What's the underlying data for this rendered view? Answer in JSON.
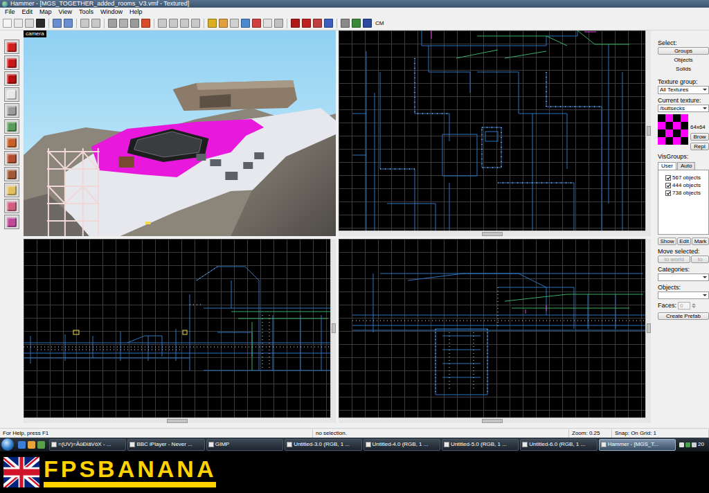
{
  "window": {
    "title": "Hammer - [MGS_TOGETHER_added_rooms_V3.vmf - Textured]"
  },
  "menu": [
    "File",
    "Edit",
    "Map",
    "View",
    "Tools",
    "Window",
    "Help"
  ],
  "toolbar": {
    "label": "CM"
  },
  "viewports": [
    {
      "label": "camera"
    }
  ],
  "select": {
    "label": "Select:",
    "buttons": [
      "Groups",
      "Objects",
      "Solids"
    ]
  },
  "texture": {
    "group_label": "Texture group:",
    "group": "All Textures",
    "current_label": "Current texture:",
    "current": "/buttsecks",
    "size": "64x64",
    "buttons": [
      "Brow",
      "Repl"
    ]
  },
  "visgroups": {
    "label": "VisGroups:",
    "tabs": [
      {
        "label": "User",
        "selected": true
      },
      {
        "label": "Auto",
        "selected": false
      }
    ],
    "items": [
      {
        "label": "567 objects",
        "checked": true
      },
      {
        "label": "444 objects",
        "checked": true
      },
      {
        "label": "738 objects",
        "checked": true
      }
    ],
    "buttons": [
      "Show",
      "Edit",
      "Mark"
    ]
  },
  "move_selected": {
    "label": "Move selected:",
    "buttons": [
      {
        "label": "to world",
        "disabled": true
      },
      {
        "label": "to",
        "disabled": true
      }
    ]
  },
  "prefabs": {
    "categories_label": "Categories:",
    "objects_label": "Objects:",
    "faces_label": "Faces:",
    "faces": "0",
    "faces_disabled": true,
    "create": "Create Prefab"
  },
  "status_bar": [
    "For Help, press F1",
    "no selection.",
    "Zoom: 0.25",
    "Snap: On Grid: 1"
  ],
  "taskbar": {
    "items": [
      {
        "label": "=(UV)=ÂûÐiäVôX - ...",
        "selected": false
      },
      {
        "label": "BBC iPlayer - Never ...",
        "selected": false
      },
      {
        "label": "GIMP",
        "selected": false
      },
      {
        "label": "Untitled-3.0 (RGB, 1 ...",
        "selected": false
      },
      {
        "label": "Untitled-4.0 (RGB, 1 ...",
        "selected": false
      },
      {
        "label": "Untitled-5.0 (RGB, 1 ...",
        "selected": false
      },
      {
        "label": "Untitled-6.0 (RGB, 1 ...",
        "selected": false
      },
      {
        "label": "Hammer - [MGS_T...",
        "selected": true
      }
    ],
    "clock": "20"
  },
  "banner": {
    "text": "FPSBANANA"
  }
}
